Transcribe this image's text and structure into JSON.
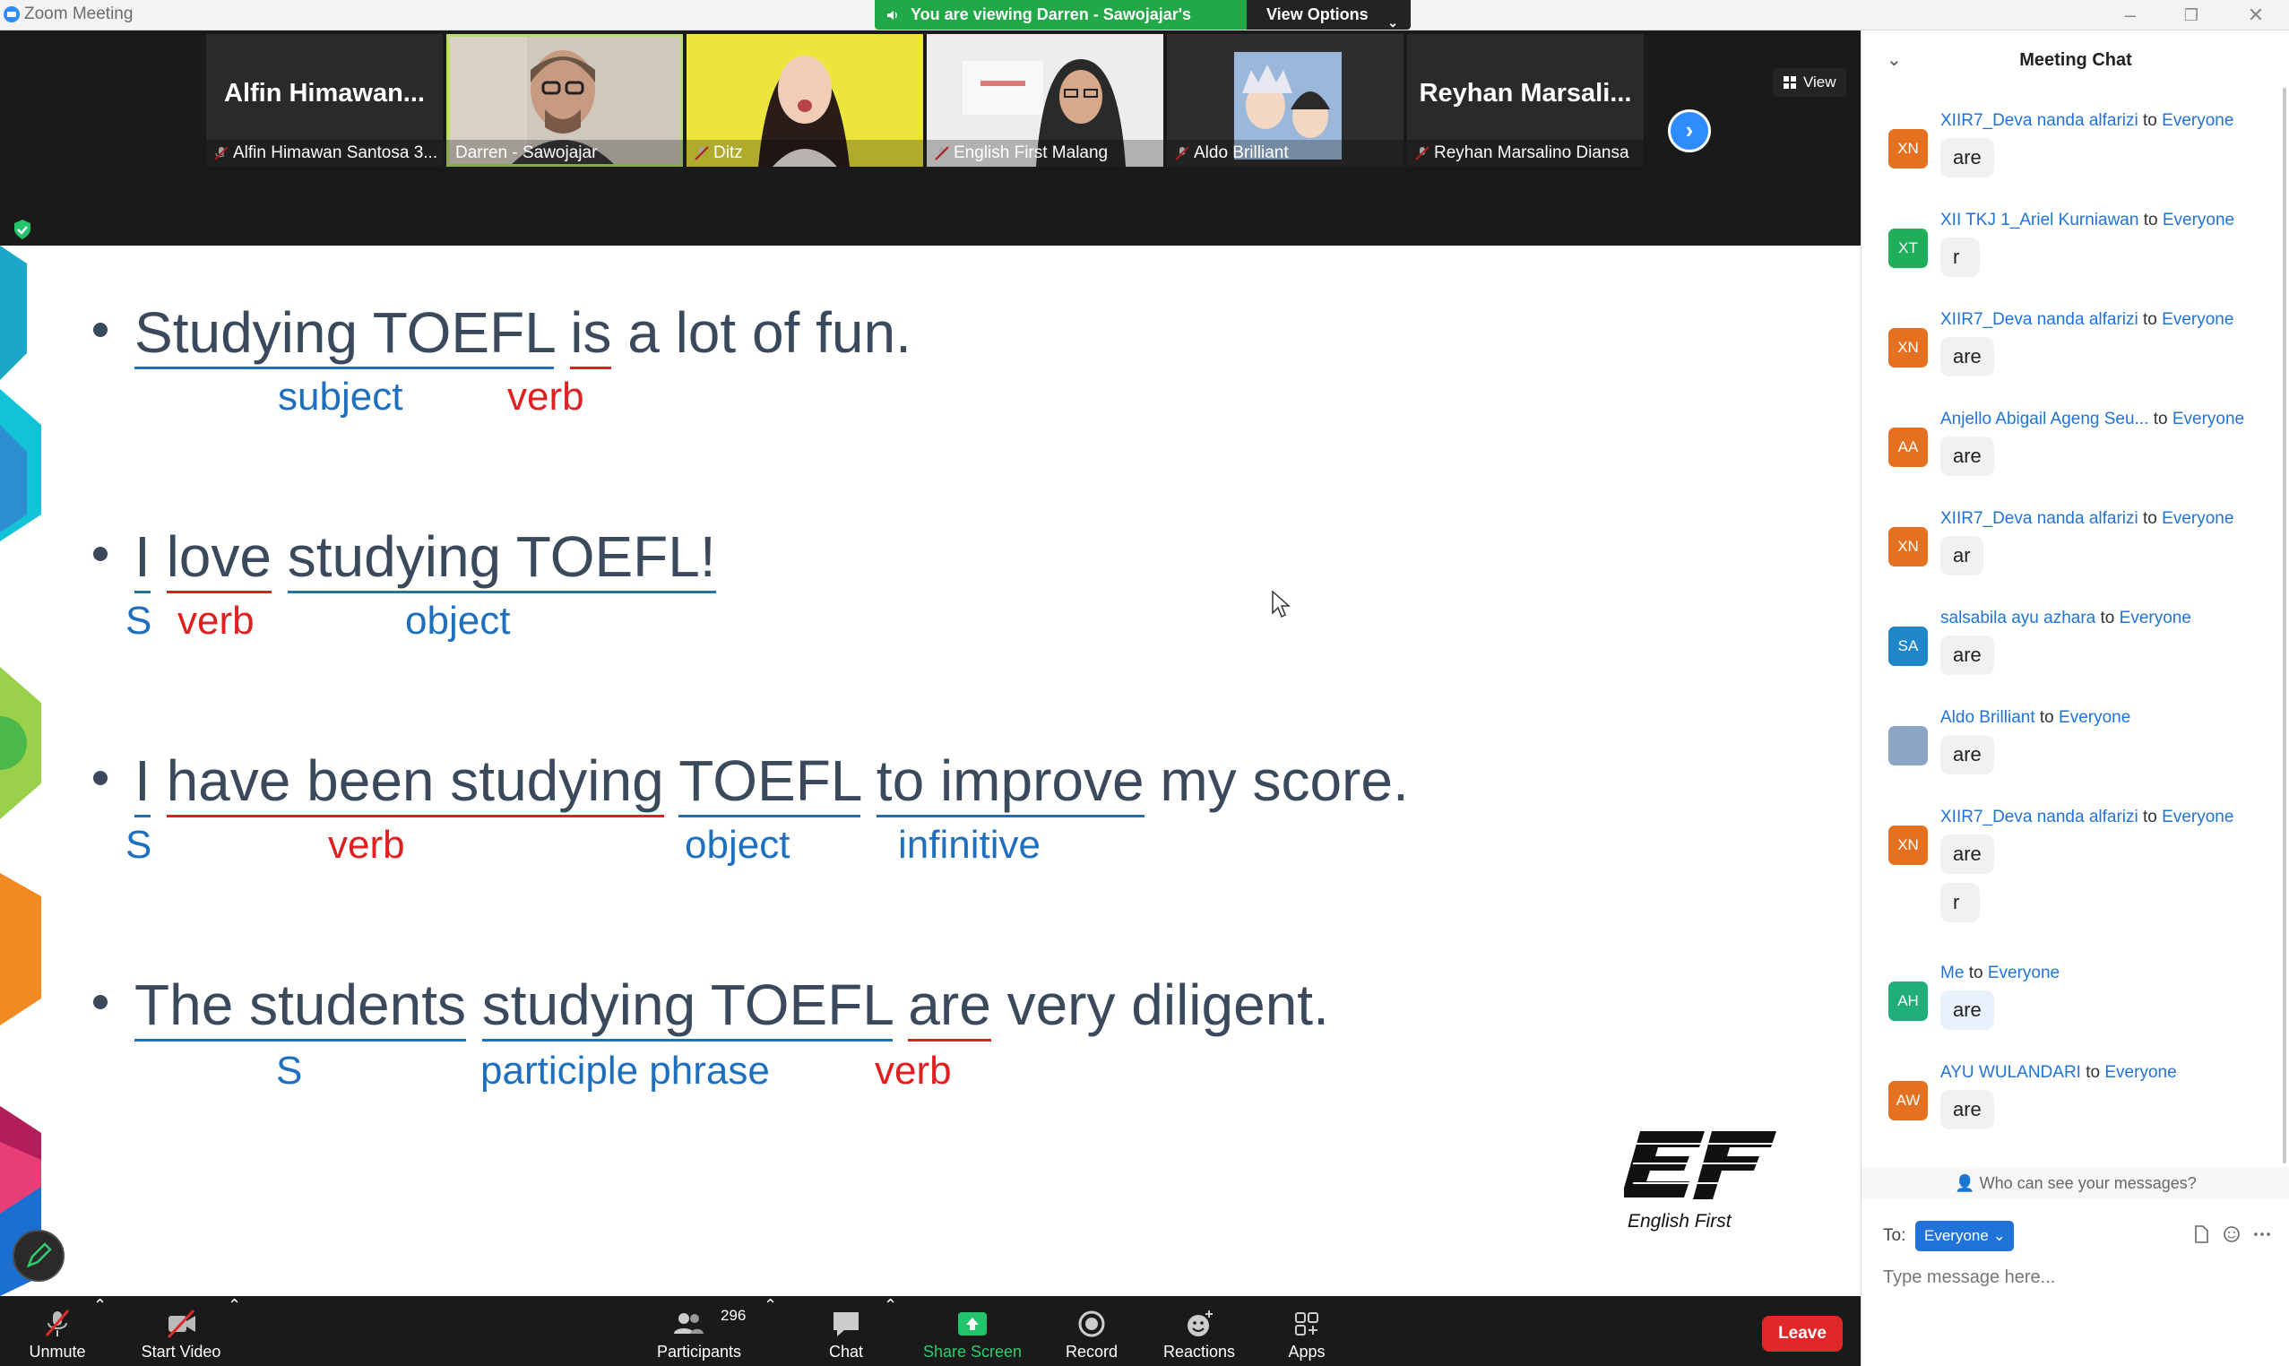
{
  "window": {
    "app_title": "Zoom Meeting",
    "viewing_banner": "You are viewing Darren - Sawojajar's screen",
    "view_options": "View Options"
  },
  "gallery": {
    "tiles": [
      {
        "big_name": "Alfin  Himawan...",
        "footer": "Alfin Himawan Santosa 3..."
      },
      {
        "footer": "Darren - Sawojajar"
      },
      {
        "footer": "Ditz"
      },
      {
        "footer": "English First Malang"
      },
      {
        "footer": "Aldo Brilliant"
      },
      {
        "big_name": "Reyhan  Marsali...",
        "footer": "Reyhan Marsalino Diansa"
      }
    ],
    "view_button": "View"
  },
  "slide": {
    "s1": {
      "text_a": "Studying TOEFL",
      "text_b": "is",
      "text_c": " a lot of fun.",
      "label_subject": "subject",
      "label_verb": "verb"
    },
    "s2": {
      "text_a": "I",
      "text_b": "love",
      "text_c": "studying TOEFL!",
      "label_s": "S",
      "label_verb": "verb",
      "label_object": "object"
    },
    "s3": {
      "text_a": "I",
      "text_b": "have been studying",
      "text_c": "TOEFL",
      "text_d": "to improve",
      "text_e": " my score.",
      "label_s": "S",
      "label_verb": "verb",
      "label_object": "object",
      "label_inf": "infinitive"
    },
    "s4": {
      "text_a": "The students",
      "text_b": "studying TOEFL",
      "text_c": "are",
      "text_d": " very diligent.",
      "label_s": "S",
      "label_pp": "participle phrase",
      "label_verb": "verb"
    },
    "logo_text": "English First"
  },
  "toolbar": {
    "unmute": "Unmute",
    "start_video": "Start Video",
    "participants": "Participants",
    "participants_count": "296",
    "chat": "Chat",
    "share_screen": "Share Screen",
    "record": "Record",
    "reactions": "Reactions",
    "apps": "Apps",
    "leave": "Leave"
  },
  "chat": {
    "title": "Meeting Chat",
    "messages": [
      {
        "initials": "XN",
        "color": "#e5701f",
        "sender": "XIIR7_Deva nanda alfarizi",
        "to": "to",
        "target": "Everyone",
        "text": "are"
      },
      {
        "initials": "XT",
        "color": "#1fae5a",
        "sender": "XII TKJ 1_Ariel Kurniawan",
        "to": "to",
        "target": "Everyone",
        "text": "r"
      },
      {
        "initials": "XN",
        "color": "#e5701f",
        "sender": "XIIR7_Deva nanda alfarizi",
        "to": "to",
        "target": "Everyone",
        "text": "are"
      },
      {
        "initials": "AA",
        "color": "#e5701f",
        "sender": "Anjello Abigail Ageng Seu...",
        "to": "to",
        "target": "Everyone",
        "text": "are"
      },
      {
        "initials": "XN",
        "color": "#e5701f",
        "sender": "XIIR7_Deva nanda alfarizi",
        "to": "to",
        "target": "Everyone",
        "text": "ar"
      },
      {
        "initials": "SA",
        "color": "#1f86c9",
        "sender": "salsabila ayu azhara",
        "to": "to",
        "target": "Everyone",
        "text": "are"
      },
      {
        "initials": "",
        "color": "#8da6c8",
        "sender": "Aldo Brilliant",
        "to": "to",
        "target": "Everyone",
        "text": "are"
      },
      {
        "initials": "XN",
        "color": "#e5701f",
        "sender": "XIIR7_Deva nanda alfarizi",
        "to": "to",
        "target": "Everyone",
        "text": "are",
        "text2": "r"
      },
      {
        "initials": "AH",
        "color": "#1fae7a",
        "sender": "Me",
        "to": "to",
        "target": "Everyone",
        "text": "are"
      },
      {
        "initials": "AW",
        "color": "#e5701f",
        "sender": "AYU WULANDARI",
        "to": "to",
        "target": "Everyone",
        "text": "are"
      }
    ],
    "who_can_see": "Who can see your messages?",
    "to_label": "To:",
    "to_value": "Everyone",
    "input_placeholder": "Type message here..."
  }
}
